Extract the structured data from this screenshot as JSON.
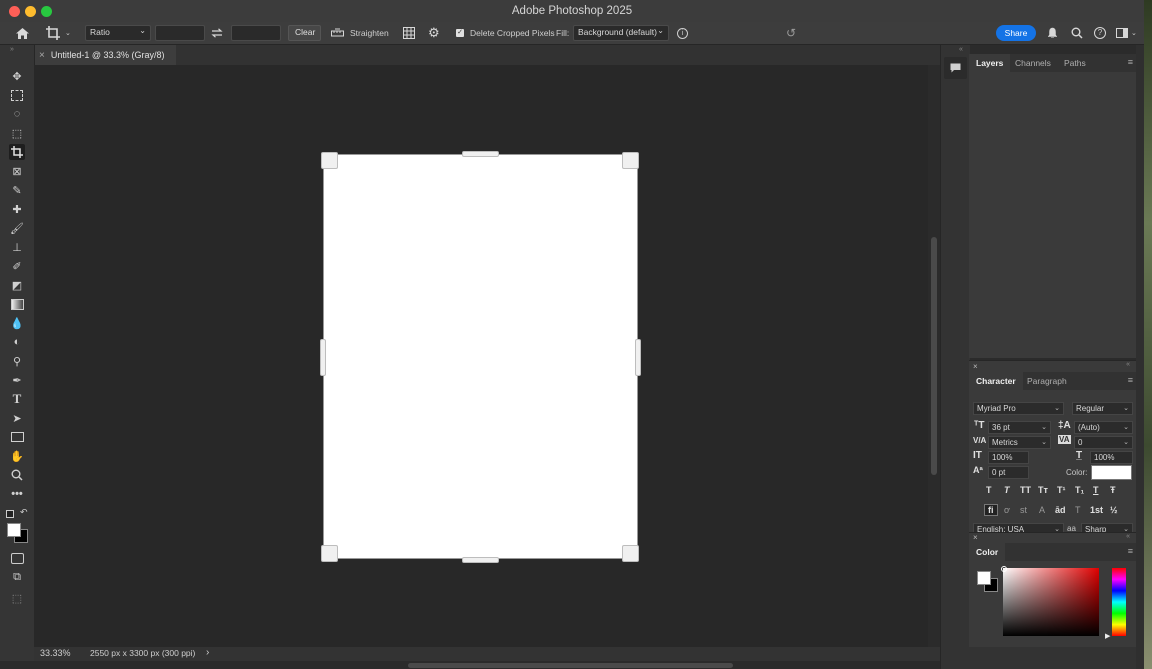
{
  "window": {
    "title": "Adobe Photoshop 2025"
  },
  "optionsbar": {
    "ratio_value": "Ratio",
    "clear_label": "Clear",
    "straighten_label": "Straighten",
    "delete_cropped_label": "Delete Cropped Pixels",
    "fill_label": "Fill:",
    "fill_value": "Background (default)",
    "share_label": "Share"
  },
  "document": {
    "tab_label": "Untitled-1 @ 33.3% (Gray/8)",
    "close_glyph": "×"
  },
  "status": {
    "zoom": "33.33%",
    "dimensions": "2550 px x 3300 px (300 ppi)",
    "arrow": "›"
  },
  "layers_panel": {
    "tabs": [
      "Layers",
      "Channels",
      "Paths"
    ]
  },
  "character_panel": {
    "tabs": [
      "Character",
      "Paragraph"
    ],
    "font_family": "Myriad Pro",
    "font_style": "Regular",
    "font_size": "36 pt",
    "leading": "(Auto)",
    "kerning": "Metrics",
    "tracking": "0",
    "vertical_scale": "100%",
    "horizontal_scale": "100%",
    "baseline_shift": "0 pt",
    "color_label": "Color:",
    "language": "English: USA",
    "antialias_prefix": "aa",
    "antialias": "Sharp",
    "style_glyphs": [
      "T",
      "T",
      "TT",
      "Tт",
      "T¹",
      "T₁",
      "T",
      "Ŧ"
    ],
    "ot_glyphs": [
      "fi",
      "ơ",
      "st",
      "A",
      "ād",
      "T",
      "1st",
      "½"
    ]
  },
  "color_panel": {
    "tab": "Color"
  },
  "colors": {
    "accent_blue": "#1473e6",
    "close_red": "#fe5f57",
    "minimize_yellow": "#febc2e",
    "zoom_green": "#28c840"
  }
}
